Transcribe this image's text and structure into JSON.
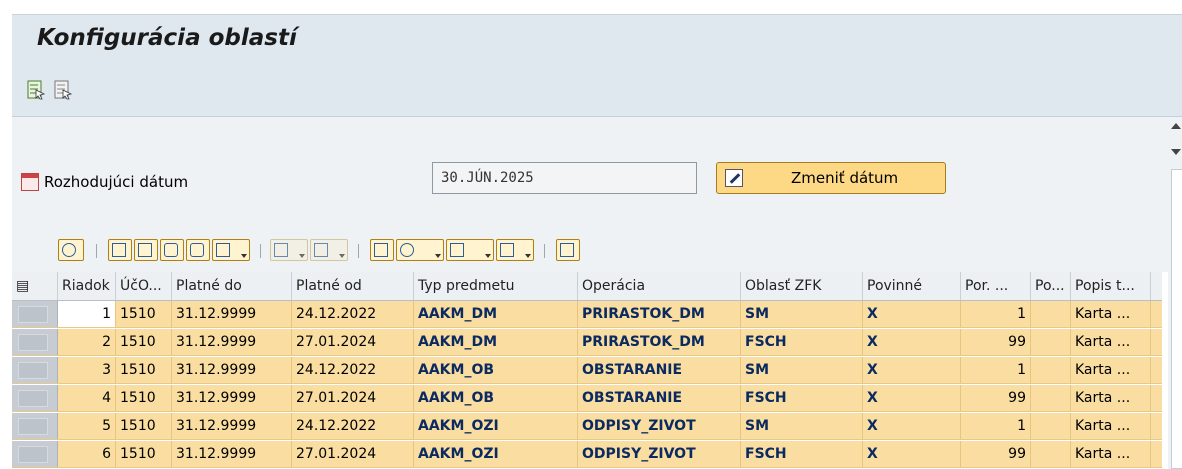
{
  "title": "Konfigurácia oblastí",
  "appbar": {
    "icons": [
      "select-all-icon",
      "deselect-all-icon"
    ]
  },
  "date": {
    "label": "Rozhodujúci dátum",
    "value": "30.JÚN.2025",
    "button_label": "Zmeniť dátum"
  },
  "toolbar": {
    "icons": [
      "details-icon",
      "sort-ascending-icon",
      "sort-descending-icon",
      "find-icon",
      "find-next-icon",
      "filter-icon",
      "sum-icon",
      "subtotal-icon",
      "print-icon",
      "views-icon",
      "export-icon",
      "layout-icon",
      "info-icon"
    ]
  },
  "table": {
    "columns": [
      "Riadok",
      "ÚčO...",
      "Platné do",
      "Platné od",
      "Typ predmetu",
      "Operácia",
      "Oblasť ZFK",
      "Povinné",
      "Por. ...",
      "Po...",
      "Popis t..."
    ],
    "rows": [
      [
        "1",
        "1510",
        "31.12.9999",
        "24.12.2022",
        "AAKM_DM",
        "PRIRASTOK_DM",
        "SM",
        "X",
        "1",
        "",
        "Karta ..."
      ],
      [
        "2",
        "1510",
        "31.12.9999",
        "27.01.2024",
        "AAKM_DM",
        "PRIRASTOK_DM",
        "FSCH",
        "X",
        "99",
        "",
        "Karta ..."
      ],
      [
        "3",
        "1510",
        "31.12.9999",
        "24.12.2022",
        "AAKM_OB",
        "OBSTARANIE",
        "SM",
        "X",
        "1",
        "",
        "Karta ..."
      ],
      [
        "4",
        "1510",
        "31.12.9999",
        "27.01.2024",
        "AAKM_OB",
        "OBSTARANIE",
        "FSCH",
        "X",
        "99",
        "",
        "Karta ..."
      ],
      [
        "5",
        "1510",
        "31.12.9999",
        "24.12.2022",
        "AAKM_OZI",
        "ODPISY_ZIVOT",
        "SM",
        "X",
        "1",
        "",
        "Karta ..."
      ],
      [
        "6",
        "1510",
        "31.12.9999",
        "27.01.2024",
        "AAKM_OZI",
        "ODPISY_ZIVOT",
        "FSCH",
        "X",
        "99",
        "",
        "Karta ..."
      ]
    ]
  }
}
